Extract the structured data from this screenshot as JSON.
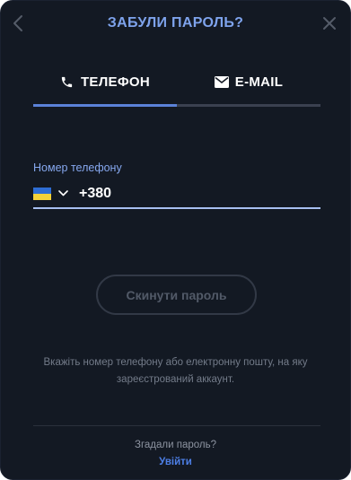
{
  "modal": {
    "title": "ЗАБУЛИ ПАРОЛЬ?",
    "back_icon": "chevron-left-icon",
    "close_icon": "close-icon"
  },
  "tabs": [
    {
      "label": "ТЕЛЕФОН",
      "icon": "phone-icon",
      "active": true
    },
    {
      "label": "E-MAIL",
      "icon": "envelope-icon",
      "active": false
    }
  ],
  "phone": {
    "label": "Номер телефону",
    "country_flag": "ukraine-flag",
    "value": "+380"
  },
  "reset_button": "Скинути пароль",
  "hint": "Вкажіть номер телефону або електронну пошту, на яку зареєстрований аккаунт.",
  "footer": {
    "remember_text": "Згадали пароль?",
    "login_link": "Увійти"
  },
  "colors": {
    "background": "#131923",
    "accent": "#5b82d8",
    "title": "#7ea3ec",
    "link": "#4d7fe6"
  }
}
